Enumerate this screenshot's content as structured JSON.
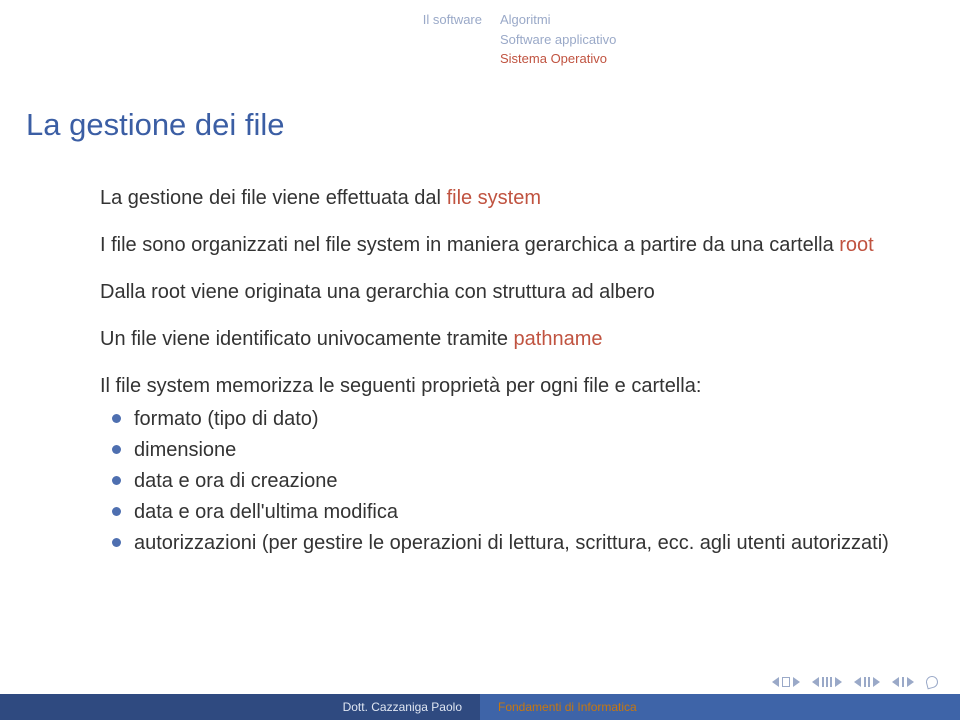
{
  "header": {
    "left_section": "Il software",
    "right_items": [
      "Algoritmi",
      "Software applicativo",
      "Sistema Operativo"
    ],
    "right_selected_index": 2
  },
  "title": "La gestione dei file",
  "content": {
    "p1_a": "La gestione dei file viene effettuata dal ",
    "p1_hl": "file system",
    "p2_a": "I file sono organizzati nel file system in maniera gerarchica a partire da una cartella ",
    "p2_hl": "root",
    "p3": "Dalla root viene originata una gerarchia con struttura ad albero",
    "p4_a": "Un file viene identificato univocamente tramite ",
    "p4_hl": "pathname",
    "p5": "Il file system memorizza le seguenti proprietà per ogni file e cartella:",
    "bullets": [
      "formato (tipo di dato)",
      "dimensione",
      "data e ora di creazione",
      "data e ora dell'ultima modifica",
      "autorizzazioni (per gestire le operazioni di lettura, scrittura, ecc. agli utenti autorizzati)"
    ]
  },
  "footer": {
    "author": "Dott. Cazzaniga Paolo",
    "course": "Fondamenti di Informatica"
  }
}
